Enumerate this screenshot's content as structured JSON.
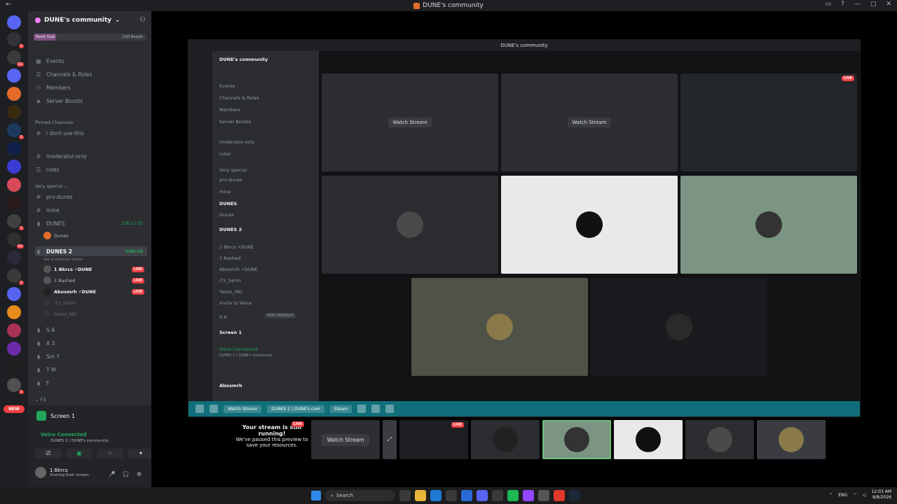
{
  "window": {
    "title": "DUNE's community",
    "back_glyph": "←",
    "controls": [
      "▭",
      "?",
      "—",
      "▢",
      "✕"
    ]
  },
  "guild_badges": [
    "1",
    "12",
    "5",
    "1",
    "42",
    "2",
    "1"
  ],
  "guild_new_pill": "NEW",
  "server": {
    "name": "DUNE's community",
    "boost_goal": "Boost Goal",
    "boost_count": "1/33 Boosts"
  },
  "channels": {
    "events": "Events",
    "channels_roles": "Channels & Roles",
    "members": "Members",
    "server_boosts": "Server Boosts",
    "pinned_header": "Pinned Channels",
    "pinned": "i dont-use-this",
    "moderator_only": "moderator-only",
    "rules": "rules",
    "very_special": "Very special",
    "prv_dunes": "prv-dunes",
    "mine": "mine",
    "dunes": "DUNES",
    "dunes_time": "236:11:33",
    "dunes_user": "Dunes",
    "dunes2": "DUNES 2",
    "dunes2_time": "2:60:16",
    "set_status": "Set a channel status",
    "sa": "S A",
    "a3": "A 3",
    "smy": "Sm Y",
    "tm": "T M",
    "f": "F",
    "f3": "F3"
  },
  "voice_users": [
    {
      "name": "1 Bkrcs ⚡DUNE",
      "live": "LIVE"
    },
    {
      "name": "1 Rashed",
      "live": "LIVE"
    },
    {
      "name": "Abosmrh ⚡DUNE",
      "live": "LIVE"
    },
    {
      "name": "iTz_3aYm",
      "live": ""
    },
    {
      "name": "Yazan_MD",
      "live": ""
    }
  ],
  "panel": {
    "screen_label": "Screen 1",
    "voice_connected": "Voice Connected",
    "voice_sub": "DUNES 2 / DUNE's community",
    "username": "1 Bkrcs",
    "user_status": "Sharing their screen",
    "buttons": [
      "⎚",
      "▣",
      "⁘",
      "✦"
    ],
    "controls": [
      "🎤",
      "🎧",
      "⚙"
    ]
  },
  "inner": {
    "title": "DUNE's community",
    "server_name": "DUNE's community",
    "items": [
      "Events",
      "Channels & Roles",
      "Members",
      "Server Boosts",
      "moderator-only",
      "rules",
      "Very special",
      "prv-dunes",
      "mine",
      "DUNES",
      "Dunes",
      "DUNES 2",
      "1 Bkrcs ⚡DUNE",
      "1 Rashed",
      "Abosmrh ⚡DUNE",
      "iTz_3aYm",
      "Yazan_MD",
      "Invite to Voice",
      "S A"
    ],
    "watch_stream": "Watch Stream",
    "live": "LIVE",
    "new_unreads": "NEW UNREADS",
    "screen_label": "Screen 1",
    "voice_connected": "Voice Connected",
    "voice_sub": "DUNES 2 / DUNE's community",
    "username": "Abosmrh",
    "taskbar_items": [
      "Watch Stream",
      "DUNES 2 | DUNE's com",
      "Steam"
    ]
  },
  "strip": {
    "msg_title": "Your stream is still running!",
    "msg_body": "We've paused this preview to save your resources.",
    "live": "LIVE",
    "watch_stream": "Watch Stream"
  },
  "taskbar": {
    "search": "Search",
    "lang": "ENG",
    "time": "12:03 AM",
    "date": "8/8/2026"
  }
}
